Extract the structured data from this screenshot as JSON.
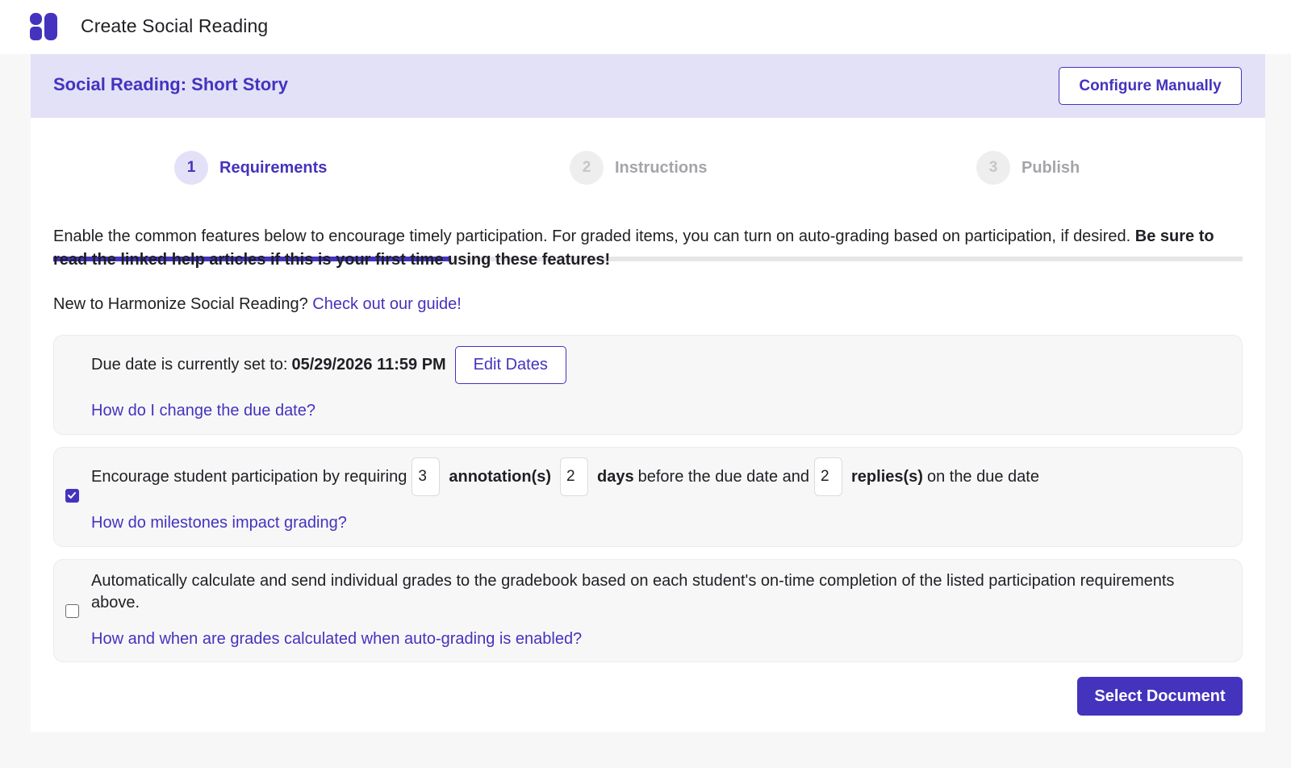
{
  "app": {
    "title": "Create Social Reading"
  },
  "banner": {
    "title": "Social Reading: Short Story",
    "configure_label": "Configure Manually"
  },
  "stepper": {
    "steps": [
      {
        "number": "1",
        "label": "Requirements",
        "state": "active"
      },
      {
        "number": "2",
        "label": "Instructions",
        "state": "inactive"
      },
      {
        "number": "3",
        "label": "Publish",
        "state": "inactive"
      }
    ],
    "progress_fraction": 0.333
  },
  "intro": {
    "text": "Enable the common features below to encourage timely participation. For graded items, you can turn on auto-grading based on participation, if desired.",
    "bold": "Be sure to read the linked help articles if this is your first time using these features!"
  },
  "guide": {
    "prefix": "New to Harmonize Social Reading?",
    "link": "Check out our guide!"
  },
  "due_date": {
    "prefix": "Due date is currently set to:",
    "value": "05/29/2026 11:59 PM",
    "edit_label": "Edit Dates",
    "help_link": "How do I change the due date?"
  },
  "milestones": {
    "checked": true,
    "text_1": "Encourage student participation by requiring",
    "annotations_value": "3",
    "annotations_label": "annotation(s)",
    "days_value": "2",
    "days_label": "days",
    "text_2": "before the due date and",
    "replies_value": "2",
    "replies_label": "replies(s)",
    "text_3": "on the due date",
    "help_link": "How do milestones impact grading?"
  },
  "auto_grading": {
    "checked": false,
    "text": "Automatically calculate and send individual grades to the gradebook based on each student's on-time completion of the listed participation requirements above.",
    "help_link": "How and when are grades calculated when auto-grading is enabled?"
  },
  "footer": {
    "primary_label": "Select Document"
  },
  "colors": {
    "accent": "#4433bd",
    "banner_bg": "#e3e1f8",
    "panel_bg": "#f7f7f8"
  }
}
